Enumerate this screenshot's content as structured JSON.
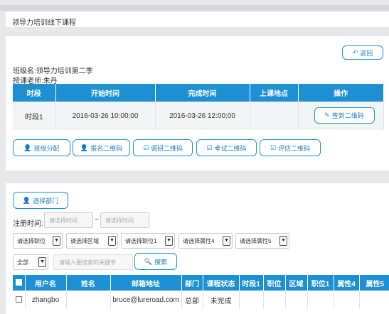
{
  "page": {
    "title": "领导力培训线下课程"
  },
  "course": {
    "back_label": "返回",
    "class_name": "班级名:领导力培训第二季",
    "teacher": "授课老师:朱丹"
  },
  "session_table": {
    "headers": [
      "时段",
      "开始时间",
      "完成时间",
      "上课地点",
      "操作"
    ],
    "rows": [
      {
        "period": "时段1",
        "start": "2016-03-26 10:00:00",
        "end": "2016-03-26 12:00:00",
        "location": "",
        "action": "签到二维码"
      }
    ]
  },
  "actions": {
    "class_assign": "班级分配",
    "signup_qr": "报名二维码",
    "survey_qr": "调研二维码",
    "exam_qr": "考试二维码",
    "eval_qr": "评估二维码"
  },
  "filters": {
    "select_dept": "选择部门",
    "reg_time_label": "注册时间:",
    "time_start_placeholder": "请选择时间",
    "tilde": "~",
    "time_end_placeholder": "请选择时间",
    "position": "请选择职位",
    "region": "请选择区域",
    "position1": "请选择职位1",
    "attr4": "请选择属性4",
    "attr5": "请选择属性5",
    "scope": "全部",
    "keyword_placeholder": "请输入要搜索的关键字",
    "search": "搜索",
    "arrow": "▼"
  },
  "user_table": {
    "headers": [
      "用户名",
      "姓名",
      "邮箱地址",
      "部门",
      "课程状态",
      "时段1",
      "职位",
      "区域",
      "职位1",
      "属性4",
      "属性5"
    ],
    "rows": [
      {
        "username": "zhangbo",
        "name": "",
        "email": "bruce@lureroad.com",
        "dept": "总部",
        "status": "未完成",
        "s1": "",
        "pos": "",
        "region": "",
        "pos1": "",
        "a4": "",
        "a5": ""
      }
    ]
  },
  "icons": {
    "back": "undo-icon",
    "qr": "pencil-icon",
    "user": "user-icon",
    "check": "check-square-icon",
    "search": "search-icon"
  },
  "colors": {
    "accent": "#1d8fd3",
    "background": "#e6e8ec"
  }
}
